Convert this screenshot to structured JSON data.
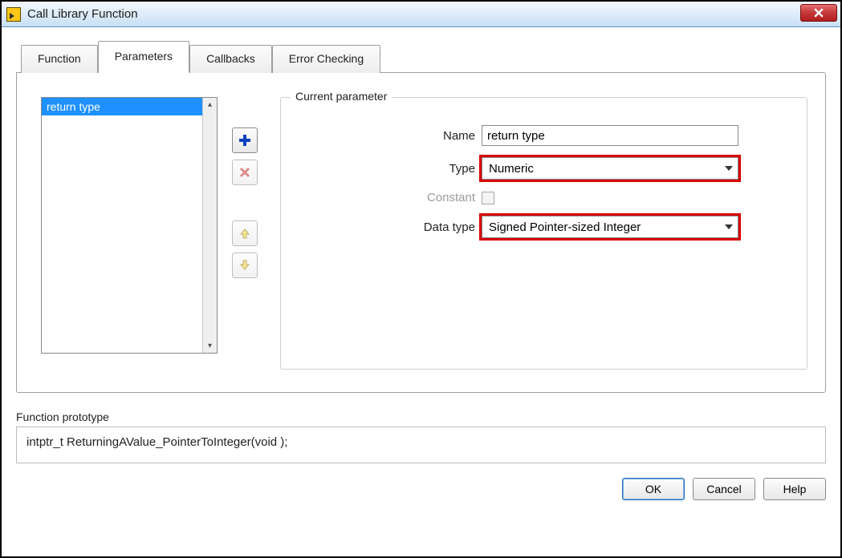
{
  "window": {
    "title": "Call Library Function"
  },
  "tabs": {
    "items": [
      "Function",
      "Parameters",
      "Callbacks",
      "Error Checking"
    ],
    "active_index": 1
  },
  "param_list": {
    "items": [
      "return type"
    ],
    "selected_index": 0
  },
  "buttons": {
    "add_tip": "Add",
    "remove_tip": "Remove",
    "up_tip": "Move Up",
    "down_tip": "Move Down"
  },
  "current_param": {
    "legend": "Current parameter",
    "name_label": "Name",
    "name_value": "return type",
    "type_label": "Type",
    "type_value": "Numeric",
    "constant_label": "Constant",
    "constant_checked": false,
    "datatype_label": "Data type",
    "datatype_value": "Signed Pointer-sized Integer"
  },
  "prototype": {
    "label": "Function prototype",
    "text": "intptr_t ReturningAValue_PointerToInteger(void );"
  },
  "footer": {
    "ok": "OK",
    "cancel": "Cancel",
    "help": "Help"
  }
}
